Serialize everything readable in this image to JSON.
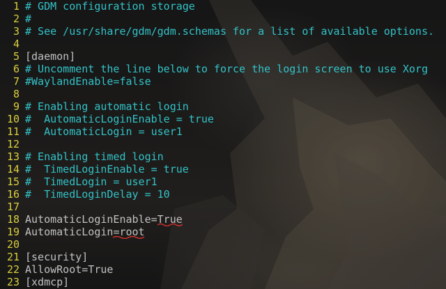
{
  "editor": {
    "lines": [
      {
        "n": "1",
        "text": "# GDM configuration storage",
        "kind": "comment"
      },
      {
        "n": "2",
        "text": "#",
        "kind": "comment"
      },
      {
        "n": "3",
        "text": "# See /usr/share/gdm/gdm.schemas for a list of available options.",
        "kind": "comment"
      },
      {
        "n": "4",
        "text": "",
        "kind": "plain"
      },
      {
        "n": "5",
        "text": "[daemon]",
        "kind": "plain"
      },
      {
        "n": "6",
        "text": "# Uncomment the line below to force the login screen to use Xorg",
        "kind": "comment"
      },
      {
        "n": "7",
        "text": "#WaylandEnable=false",
        "kind": "comment"
      },
      {
        "n": "8",
        "text": "",
        "kind": "plain"
      },
      {
        "n": "9",
        "text": "# Enabling automatic login",
        "kind": "comment"
      },
      {
        "n": "10",
        "text": "#  AutomaticLoginEnable = true",
        "kind": "comment"
      },
      {
        "n": "11",
        "text": "#  AutomaticLogin = user1",
        "kind": "comment"
      },
      {
        "n": "12",
        "text": "",
        "kind": "plain"
      },
      {
        "n": "13",
        "text": "# Enabling timed login",
        "kind": "comment"
      },
      {
        "n": "14",
        "text": "#  TimedLoginEnable = true",
        "kind": "comment"
      },
      {
        "n": "15",
        "text": "#  TimedLogin = user1",
        "kind": "comment"
      },
      {
        "n": "16",
        "text": "#  TimedLoginDelay = 10",
        "kind": "comment"
      },
      {
        "n": "17",
        "text": "",
        "kind": "plain"
      },
      {
        "n": "18",
        "text": "AutomaticLoginEnable=True",
        "kind": "plain",
        "marked": "True"
      },
      {
        "n": "19",
        "text": "AutomaticLogin=root",
        "kind": "plain",
        "marked": "=root"
      },
      {
        "n": "20",
        "text": "",
        "kind": "plain"
      },
      {
        "n": "21",
        "text": "[security]",
        "kind": "plain"
      },
      {
        "n": "22",
        "text": "AllowRoot=True",
        "kind": "plain"
      },
      {
        "n": "23",
        "text": "[xdmcp]",
        "kind": "plain"
      }
    ]
  },
  "colors": {
    "line_number": "#d9cf3d",
    "comment": "#33c2c7",
    "plain": "#c2c2c2",
    "annotation": "#d0312d"
  }
}
